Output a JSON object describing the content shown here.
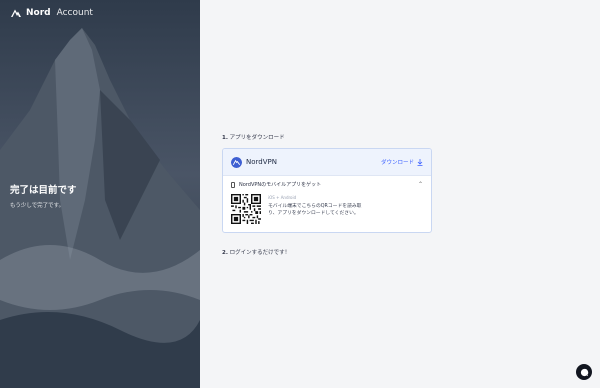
{
  "brand": {
    "name": "Nord",
    "product": "Account"
  },
  "hero": {
    "title": "完了は目前です",
    "subtitle": "もう少しで完了です。"
  },
  "steps": {
    "step1": {
      "number": "1.",
      "label": "アプリをダウンロード"
    },
    "step2": {
      "number": "2.",
      "label": "ログインするだけです！"
    }
  },
  "download_card": {
    "app_name": "NordVPN",
    "download_label": "ダウンロード",
    "mobile_label": "NordVPNのモバイルアプリをゲット",
    "os_label": "iOS + Android",
    "qr_description": "モバイル端末でこちらのQRコードを読み取り、アプリをダウンロードしてください。"
  },
  "colors": {
    "accent": "#3e62ff",
    "card_border": "#c9d7f2",
    "card_head": "#eef3fd",
    "chat_bg": "#121620"
  },
  "icons": [
    "nord-logo-icon",
    "nordvpn-icon",
    "download-icon",
    "phone-icon",
    "chevron-up-icon",
    "qr-code-icon",
    "chat-icon"
  ]
}
